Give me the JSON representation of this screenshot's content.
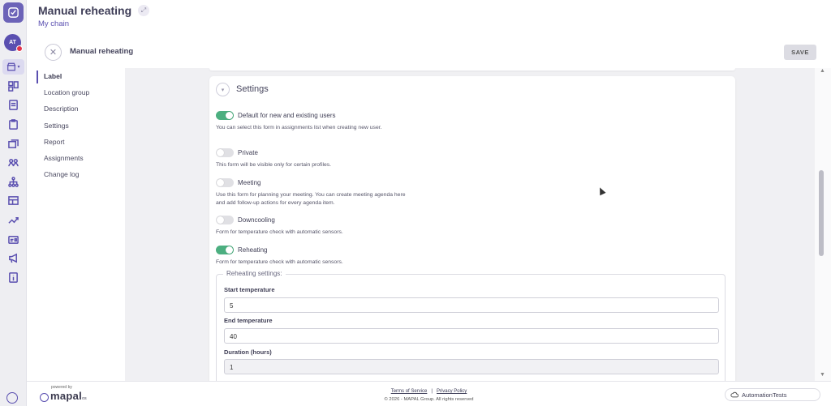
{
  "header": {
    "title": "Manual reheating",
    "subtitle": "My chain",
    "form_title": "Manual reheating",
    "save_label": "SAVE"
  },
  "rail": {
    "avatar_initials": "AT",
    "icons": [
      "dashboard-icon",
      "document-icon",
      "clipboard-icon",
      "layers-icon",
      "people-icon",
      "hierarchy-icon",
      "table-icon",
      "trend-icon",
      "id-card-icon",
      "megaphone-icon",
      "info-icon"
    ]
  },
  "sidenav": {
    "items": [
      "Label",
      "Location group",
      "Description",
      "Settings",
      "Report",
      "Assignments",
      "Change log"
    ]
  },
  "settings": {
    "title": "Settings",
    "toggles": [
      {
        "label": "Default for new and existing users",
        "state": "on",
        "desc": "You can select this form in assignments list when creating new user."
      },
      {
        "label": "Private",
        "state": "off",
        "desc": "This form will be visible only for certain profiles."
      },
      {
        "label": "Meeting",
        "state": "off",
        "desc": "Use this form for planning your meeting. You can create meeting agenda here and add follow-up actions for every agenda item."
      },
      {
        "label": "Downcooling",
        "state": "off",
        "desc": "Form for temperature check with automatic sensors."
      },
      {
        "label": "Reheating",
        "state": "on",
        "desc": "Form for temperature check with automatic sensors."
      }
    ],
    "reheating": {
      "legend": "Reheating settings:",
      "fields": [
        {
          "label": "Start temperature",
          "value": "5"
        },
        {
          "label": "End temperature",
          "value": "40"
        },
        {
          "label": "Duration (hours)",
          "value": "1"
        }
      ]
    }
  },
  "footer": {
    "powered_by": "powered by",
    "brand": "mapal",
    "brand_suffix": "os",
    "terms": "Terms of Service",
    "separator": "|",
    "privacy": "Privacy Policy",
    "copyright": "© 2026 - MAPAL Group. All rights reserved",
    "user": "AutomationTests"
  },
  "colors": {
    "accent": "#5a4fb0",
    "toggle_on": "#4caf80",
    "avatar_dot": "#e2334a"
  }
}
